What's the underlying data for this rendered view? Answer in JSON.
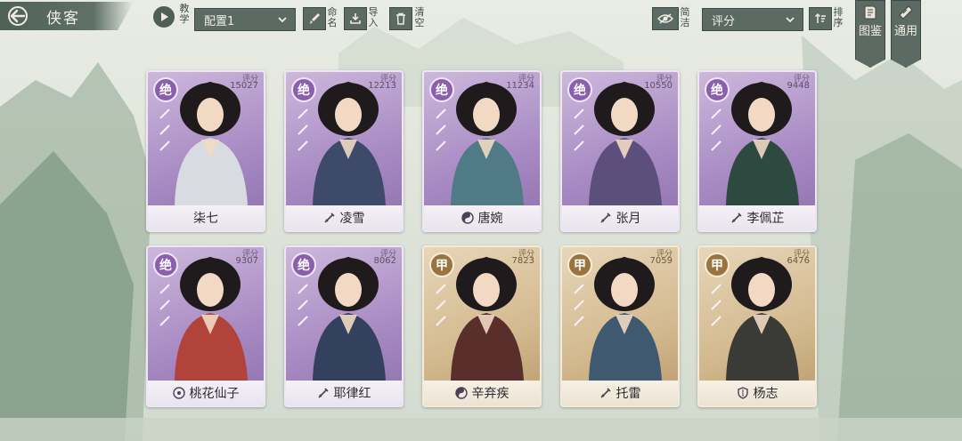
{
  "header": {
    "title": "侠客",
    "tutorial_label": "教学",
    "preset_value": "配置1",
    "rename_label": "命名",
    "import_label": "导入",
    "clear_label": "清空",
    "simple_label": "简洁",
    "sort_value": "评分",
    "sort_label": "排序",
    "codex_label": "图鉴",
    "general_label": "通用"
  },
  "score_label": "评分",
  "cards": [
    {
      "rank": "绝",
      "score": "15027",
      "name": "柒七",
      "tier": "jue",
      "icon": "none-icon",
      "robe": "#d8dce2"
    },
    {
      "rank": "绝",
      "score": "12213",
      "name": "凌雪",
      "tier": "jue",
      "icon": "sword-icon",
      "robe": "#3e4a6a"
    },
    {
      "rank": "绝",
      "score": "11234",
      "name": "唐婉",
      "tier": "jue",
      "icon": "yinyang-icon",
      "robe": "#4f7a86"
    },
    {
      "rank": "绝",
      "score": "10550",
      "name": "张月",
      "tier": "jue",
      "icon": "sword-icon",
      "robe": "#5d4f7c"
    },
    {
      "rank": "绝",
      "score": "9448",
      "name": "李佩芷",
      "tier": "jue",
      "icon": "sword-icon",
      "robe": "#2e4a40"
    },
    {
      "rank": "绝",
      "score": "9307",
      "name": "桃花仙子",
      "tier": "jue",
      "icon": "flower-icon",
      "robe": "#b2433b"
    },
    {
      "rank": "绝",
      "score": "8062",
      "name": "耶律红",
      "tier": "jue",
      "icon": "sword-icon",
      "robe": "#33405e"
    },
    {
      "rank": "甲",
      "score": "7823",
      "name": "辛弃疾",
      "tier": "jia",
      "icon": "yinyang-icon",
      "robe": "#5a2e2a"
    },
    {
      "rank": "甲",
      "score": "7059",
      "name": "托雷",
      "tier": "jia",
      "icon": "sword-icon",
      "robe": "#3f5a70"
    },
    {
      "rank": "甲",
      "score": "6476",
      "name": "杨志",
      "tier": "jia",
      "icon": "shield-icon",
      "robe": "#3a3a36"
    }
  ],
  "colors": {
    "accent": "#5b6a63",
    "jue": "#a98cc4",
    "jia": "#d2b88d"
  }
}
